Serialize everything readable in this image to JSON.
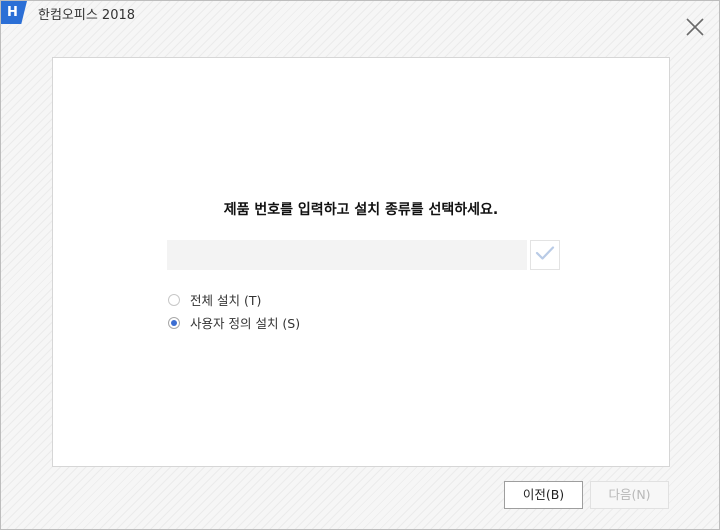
{
  "window": {
    "logo_letter": "H",
    "title": "한컴오피스 2018"
  },
  "content": {
    "headline": "제품 번호를 입력하고 설치 종류를 선택하세요.",
    "serial_value": "",
    "serial_placeholder": "",
    "install_options": [
      {
        "label": "전체 설치 (T)",
        "selected": false
      },
      {
        "label": "사용자 정의 설치 (S)",
        "selected": true
      }
    ]
  },
  "footer": {
    "prev_label": "이전(B)",
    "next_label": "다음(N)",
    "next_enabled": false
  },
  "colors": {
    "brand": "#2b6fd6",
    "radio_selected": "#3c6ed2",
    "check_icon": "#b9cbe6"
  }
}
